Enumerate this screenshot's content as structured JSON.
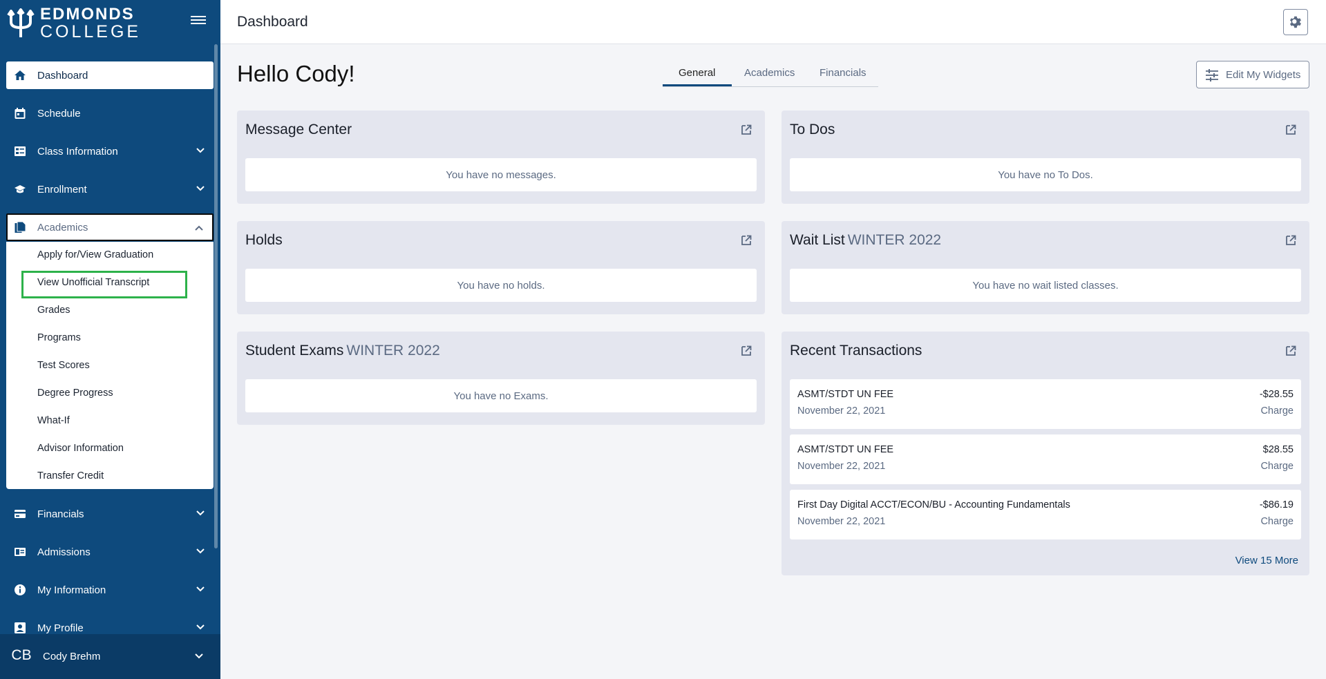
{
  "logo": {
    "line1": "EDMONDS",
    "line2": "COLLEGE"
  },
  "sidebar": {
    "items": [
      {
        "label": "Dashboard"
      },
      {
        "label": "Schedule"
      },
      {
        "label": "Class Information"
      },
      {
        "label": "Enrollment"
      },
      {
        "label": "Academics"
      },
      {
        "label": "Financials"
      },
      {
        "label": "Admissions"
      },
      {
        "label": "My Information"
      },
      {
        "label": "My Profile"
      }
    ],
    "academics_submenu": [
      "Apply for/View Graduation",
      "View Unofficial Transcript",
      "Grades",
      "Programs",
      "Test Scores",
      "Degree Progress",
      "What-If",
      "Advisor Information",
      "Transfer Credit"
    ],
    "user": {
      "initials": "CB",
      "name": "Cody Brehm"
    }
  },
  "header": {
    "title": "Dashboard"
  },
  "main": {
    "greeting": "Hello Cody!",
    "tabs": [
      {
        "label": "General",
        "active": true
      },
      {
        "label": "Academics",
        "active": false
      },
      {
        "label": "Financials",
        "active": false
      }
    ],
    "edit_widgets_label": "Edit My Widgets",
    "widgets": {
      "message_center": {
        "title": "Message Center",
        "empty": "You have no messages."
      },
      "todos": {
        "title": "To Dos",
        "empty": "You have no To Dos."
      },
      "holds": {
        "title": "Holds",
        "empty": "You have no holds."
      },
      "wait_list": {
        "title": "Wait List",
        "term": "WINTER 2022",
        "empty": "You have no wait listed classes."
      },
      "student_exams": {
        "title": "Student Exams",
        "term": "WINTER 2022",
        "empty": "You have no Exams."
      },
      "recent_transactions": {
        "title": "Recent Transactions",
        "items": [
          {
            "description": "ASMT/STDT UN FEE",
            "date": "November 22, 2021",
            "amount": "-$28.55",
            "type": "Charge"
          },
          {
            "description": "ASMT/STDT UN FEE",
            "date": "November 22, 2021",
            "amount": "$28.55",
            "type": "Charge"
          },
          {
            "description": "First Day Digital ACCT/ECON/BU - Accounting Fundamentals",
            "date": "November 22, 2021",
            "amount": "-$86.19",
            "type": "Charge"
          }
        ],
        "view_more": "View 15 More"
      }
    }
  },
  "colors": {
    "sidebar_bg": "#0e4a7d",
    "highlight": "#2db24a",
    "card_bg": "#e4e6ef"
  }
}
